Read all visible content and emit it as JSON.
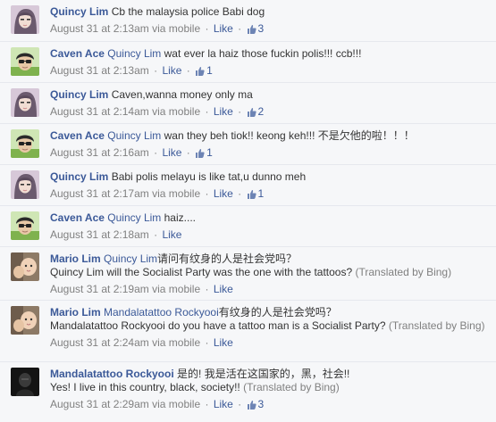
{
  "comments": [
    {
      "author": "Quincy Lim",
      "text": "Cb the malaysia police Babi dog",
      "timestamp": "August 31 at 2:13am",
      "via": "via mobile",
      "like_label": "Like",
      "like_count": "3",
      "avatar": "female"
    },
    {
      "author": "Caven Ace",
      "mention": "Quincy Lim",
      "text": " wat ever la haiz those fuckin polis!!! ccb!!!",
      "timestamp": "August 31 at 2:13am",
      "like_label": "Like",
      "like_count": "1",
      "avatar": "male"
    },
    {
      "author": "Quincy Lim",
      "text": "Caven,wanna money only ma",
      "timestamp": "August 31 at 2:14am",
      "via": "via mobile",
      "like_label": "Like",
      "like_count": "2",
      "avatar": "female"
    },
    {
      "author": "Caven Ace",
      "mention": "Quincy Lim",
      "text": " wan they beh tiok!! keong keh!!! 不是欠他的啦！！！",
      "timestamp": "August 31 at 2:16am",
      "like_label": "Like",
      "like_count": "1",
      "avatar": "male"
    },
    {
      "author": "Quincy Lim",
      "text": "Babi polis melayu is like tat,u dunno meh",
      "timestamp": "August 31 at 2:17am",
      "via": "via mobile",
      "like_label": "Like",
      "like_count": "1",
      "avatar": "female"
    },
    {
      "author": "Caven Ace",
      "mention": "Quincy Lim",
      "text": " haiz....",
      "timestamp": "August 31 at 2:18am",
      "like_label": "Like",
      "avatar": "male"
    },
    {
      "author": "Mario Lim",
      "mention": "Quincy Lim",
      "text": "请问有纹身的人是社会党吗？",
      "translation": "Quincy Lim will the Socialist Party was the one with the tattoos?",
      "bing": "(Translated by Bing)",
      "timestamp": "August 31 at 2:19am",
      "via": "via mobile",
      "like_label": "Like",
      "avatar": "baby"
    },
    {
      "author": "Mario Lim",
      "mention": "Mandalatattoo Rockyooi",
      "text": "有纹身的人是社会党吗？",
      "translation": "Mandalatattoo Rockyooi do you have a tattoo man is a Socialist Party?",
      "bing": "(Translated by Bing)",
      "timestamp": "August 31 at 2:24am",
      "via": "via mobile",
      "like_label": "Like",
      "avatar": "baby"
    },
    {
      "author": "Mandalatattoo Rockyooi",
      "text": "是的! 我是活在这国家的，黑，社会!!",
      "translation": "Yes! I live in this country, black, society!!",
      "bing": "(Translated by Bing)",
      "timestamp": "August 31 at 2:29am",
      "via": "via mobile",
      "like_label": "Like",
      "like_count": "3",
      "avatar": "dark"
    }
  ]
}
